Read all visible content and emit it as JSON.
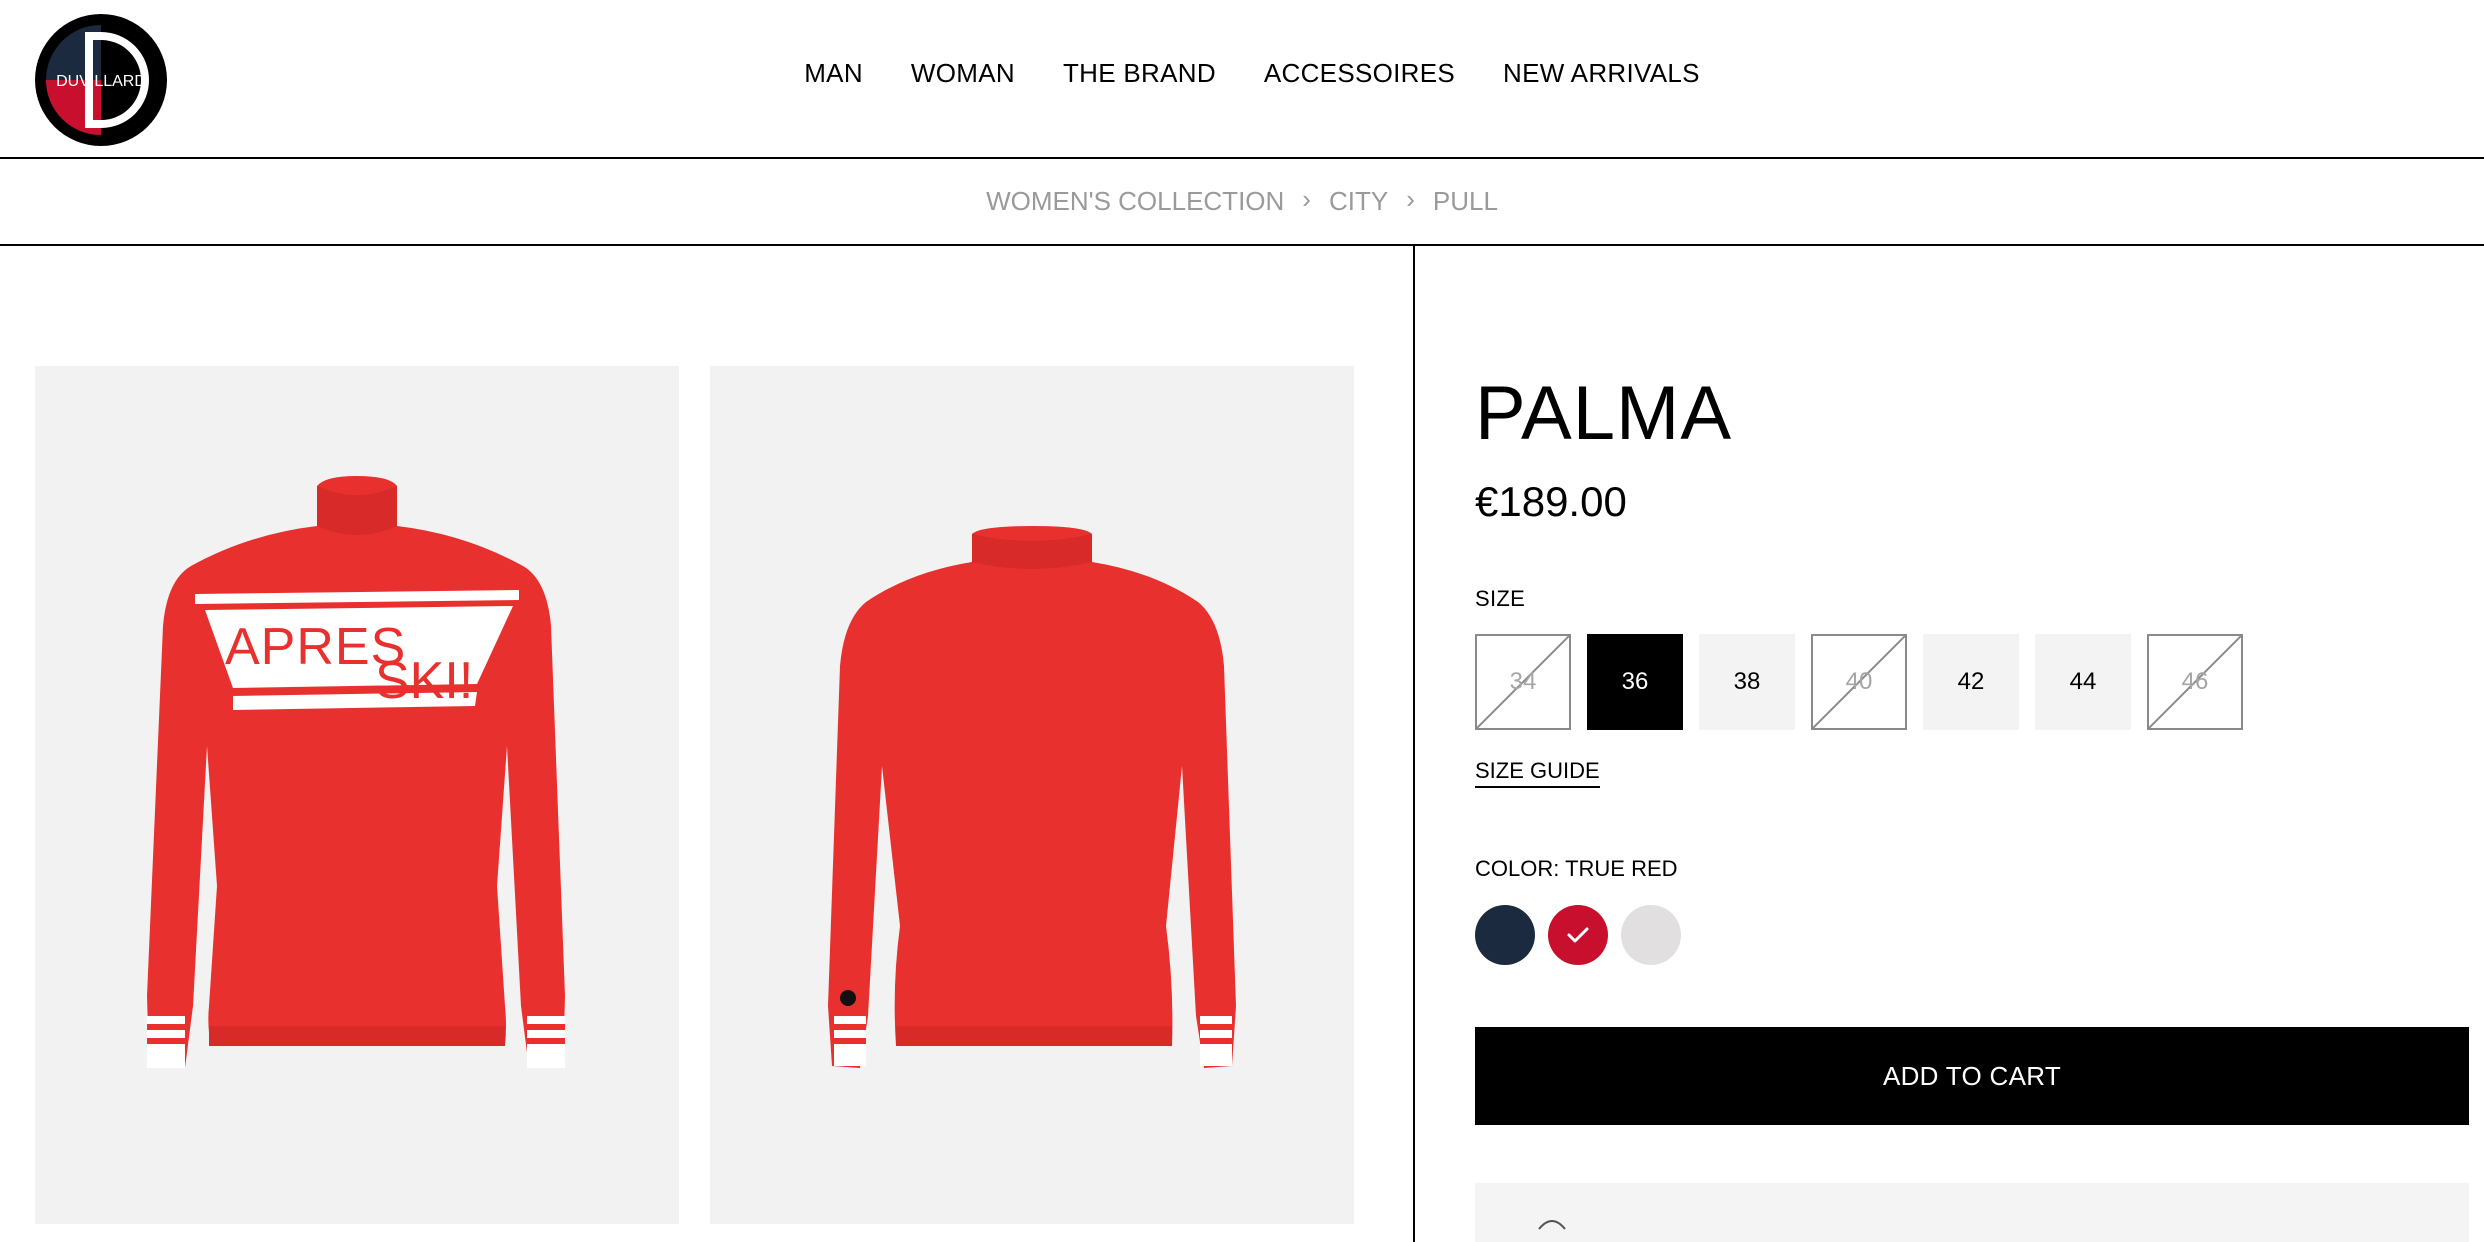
{
  "header": {
    "logo_text": "DUVILLARD",
    "nav": [
      "MAN",
      "WOMAN",
      "THE BRAND",
      "ACCESSOIRES",
      "NEW ARRIVALS"
    ]
  },
  "breadcrumb": [
    "WOMEN'S COLLECTION",
    "CITY",
    "PULL"
  ],
  "gallery": {
    "front_print_top": "APRES",
    "front_print_bottom": "SKI!"
  },
  "product": {
    "title": "PALMA",
    "price": "€189.00",
    "size_label": "SIZE",
    "sizes": [
      {
        "label": "34",
        "state": "unavailable"
      },
      {
        "label": "36",
        "state": "selected"
      },
      {
        "label": "38",
        "state": "available"
      },
      {
        "label": "40",
        "state": "unavailable"
      },
      {
        "label": "42",
        "state": "available"
      },
      {
        "label": "44",
        "state": "available"
      },
      {
        "label": "46",
        "state": "unavailable"
      }
    ],
    "size_guide": "SIZE GUIDE",
    "color_label": "COLOR: TRUE RED",
    "colors": [
      {
        "name": "navy",
        "hex": "#1b2a3e",
        "selected": false
      },
      {
        "name": "true-red",
        "hex": "#c8102e",
        "selected": true
      },
      {
        "name": "light-grey",
        "hex": "#e2dfe1",
        "selected": false
      }
    ],
    "add_to_cart": "ADD TO CART"
  },
  "colors": {
    "sweater_red": "#e8312f",
    "accent_red": "#c8102e",
    "black": "#000000"
  }
}
